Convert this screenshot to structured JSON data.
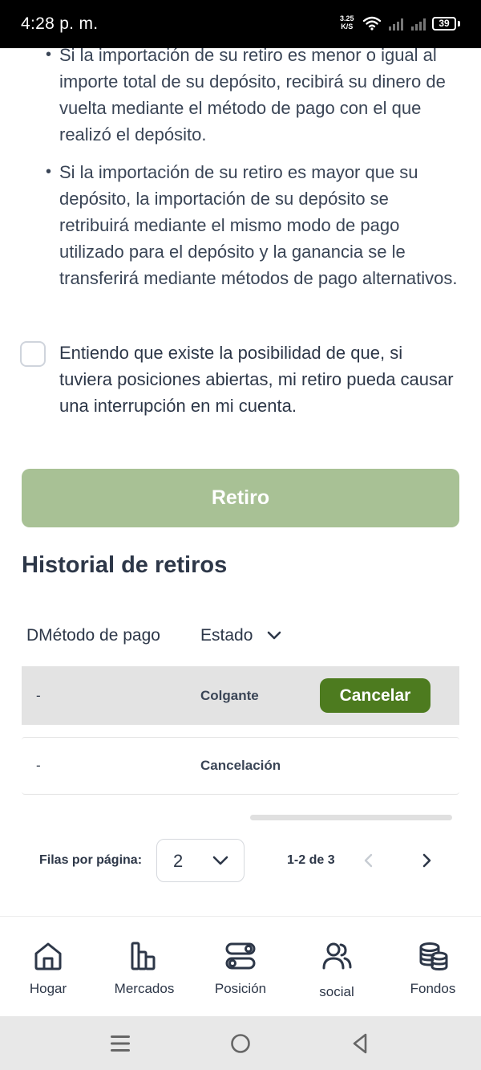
{
  "status_bar": {
    "time": "4:28 p. m.",
    "network_speed_value": "3.25",
    "network_speed_unit": "K/S",
    "battery": "39"
  },
  "info": {
    "bullet1": "Si la importación de su retiro es menor o igual al importe total de su depósito, recibirá su dinero de vuelta mediante el método de pago con el que realizó el depósito.",
    "bullet2": "Si la importación de su retiro es mayor que su depósito, la importación de su depósito se retribuirá mediante el mismo modo de pago utilizado para el depósito y la ganancia se le transferirá mediante métodos de pago alternativos."
  },
  "consent": {
    "text": "Entiendo que existe la posibilidad de que, si tuviera posiciones abiertas, mi retiro pueda causar una interrupción en mi cuenta.",
    "checked": false
  },
  "withdraw_button": "Retiro",
  "history": {
    "title": "Historial de retiros",
    "columns": [
      "DMétodo de pago",
      "Estado"
    ],
    "rows": [
      {
        "method": "-",
        "status": "Colgante",
        "action": "Cancelar"
      },
      {
        "method": "-",
        "status": "Cancelación",
        "action": ""
      }
    ]
  },
  "pagination": {
    "rows_per_page_label": "Filas por página:",
    "rows_per_page_value": "2",
    "range_text": "1-2 de 3"
  },
  "bottom_nav": [
    {
      "label": "Hogar",
      "icon": "home-icon"
    },
    {
      "label": "Mercados",
      "icon": "bar-chart-icon"
    },
    {
      "label": "Posición",
      "icon": "toggles-icon"
    },
    {
      "label": "social",
      "icon": "users-icon"
    },
    {
      "label": "Fondos",
      "icon": "coins-icon"
    }
  ],
  "colors": {
    "withdraw_button_disabled": "#a8c195",
    "cancel_button": "#4d7b1f",
    "text_dark": "#2d3748",
    "highlight_row": "#e3e3e3"
  }
}
